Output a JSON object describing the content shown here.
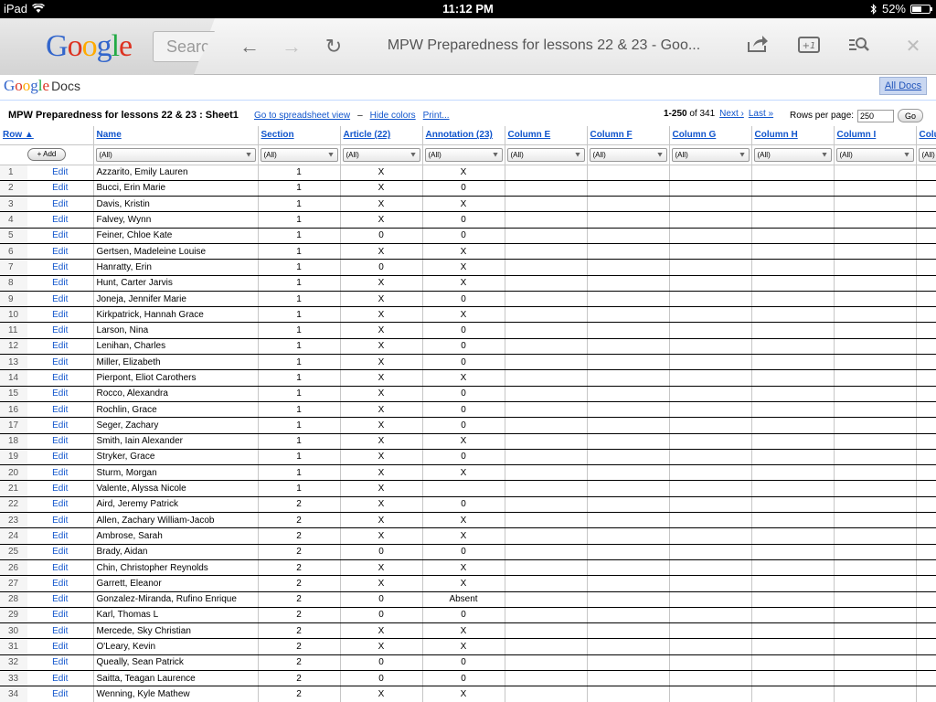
{
  "status_bar": {
    "device": "iPad",
    "time": "11:12 PM",
    "battery": "52%",
    "battery_level": 0.52
  },
  "browser": {
    "search_placeholder": "Search",
    "page_title": "MPW Preparedness for lessons 22 & 23 - Goo...",
    "google_logo": [
      "G",
      "o",
      "o",
      "g",
      "l",
      "e"
    ],
    "logo_colors": [
      "#3366cc",
      "#dd3322",
      "#ffaa00",
      "#3366cc",
      "#22aa44",
      "#dd3322"
    ]
  },
  "docs": {
    "logo_google": "Google",
    "logo_docs": "Docs",
    "all_docs": "All Docs"
  },
  "sheet": {
    "title": "MPW Preparedness for lessons 22 & 23 : Sheet1",
    "links": {
      "spreadsheet_view": "Go to spreadsheet view",
      "separator": "–",
      "hide_colors": "Hide colors",
      "print": "Print..."
    },
    "paging": {
      "range": "1-250",
      "of_text": "of 341",
      "next": "Next ›",
      "last": "Last »"
    },
    "rows_per_page_label": "Rows per page:",
    "rows_per_page_value": "250",
    "go_label": "Go",
    "add_label": "+ Add",
    "filter_all": "(All)",
    "columns": [
      "Row ▲",
      "Name",
      "Section",
      "Article (22)",
      "Annotation (23)",
      "Column E",
      "Column F",
      "Column G",
      "Column H",
      "Column I",
      "Colu"
    ],
    "edit_label": "Edit",
    "rows": [
      [
        "1",
        "Azzarito, Emily Lauren",
        "1",
        "X",
        "X"
      ],
      [
        "2",
        "Bucci, Erin Marie",
        "1",
        "X",
        "0"
      ],
      [
        "3",
        "Davis, Kristin",
        "1",
        "X",
        "X"
      ],
      [
        "4",
        "Falvey, Wynn",
        "1",
        "X",
        "0"
      ],
      [
        "5",
        "Feiner, Chloe Kate",
        "1",
        "0",
        "0"
      ],
      [
        "6",
        "Gertsen, Madeleine Louise",
        "1",
        "X",
        "X"
      ],
      [
        "7",
        "Hanratty, Erin",
        "1",
        "0",
        "X"
      ],
      [
        "8",
        "Hunt, Carter Jarvis",
        "1",
        "X",
        "X"
      ],
      [
        "9",
        "Joneja, Jennifer Marie",
        "1",
        "X",
        "0"
      ],
      [
        "10",
        "Kirkpatrick, Hannah Grace",
        "1",
        "X",
        "X"
      ],
      [
        "11",
        "Larson, Nina",
        "1",
        "X",
        "0"
      ],
      [
        "12",
        "Lenihan, Charles",
        "1",
        "X",
        "0"
      ],
      [
        "13",
        "Miller, Elizabeth",
        "1",
        "X",
        "0"
      ],
      [
        "14",
        "Pierpont, Eliot Carothers",
        "1",
        "X",
        "X"
      ],
      [
        "15",
        "Rocco, Alexandra",
        "1",
        "X",
        "0"
      ],
      [
        "16",
        "Rochlin, Grace",
        "1",
        "X",
        "0"
      ],
      [
        "17",
        "Seger, Zachary",
        "1",
        "X",
        "0"
      ],
      [
        "18",
        "Smith, Iain Alexander",
        "1",
        "X",
        "X"
      ],
      [
        "19",
        "Stryker, Grace",
        "1",
        "X",
        "0"
      ],
      [
        "20",
        "Sturm, Morgan",
        "1",
        "X",
        "X"
      ],
      [
        "21",
        "Valente, Alyssa Nicole",
        "1",
        "X",
        ""
      ],
      [
        "22",
        "Aird, Jeremy Patrick",
        "2",
        "X",
        "0"
      ],
      [
        "23",
        "Allen, Zachary William-Jacob",
        "2",
        "X",
        "X"
      ],
      [
        "24",
        "Ambrose, Sarah",
        "2",
        "X",
        "X"
      ],
      [
        "25",
        "Brady, Aidan",
        "2",
        "0",
        "0"
      ],
      [
        "26",
        "Chin, Christopher Reynolds",
        "2",
        "X",
        "X"
      ],
      [
        "27",
        "Garrett, Eleanor",
        "2",
        "X",
        "X"
      ],
      [
        "28",
        "Gonzalez-Miranda, Rufino Enrique",
        "2",
        "0",
        "Absent"
      ],
      [
        "29",
        "Karl, Thomas L",
        "2",
        "0",
        "0"
      ],
      [
        "30",
        "Mercede, Sky Christian",
        "2",
        "X",
        "X"
      ],
      [
        "31",
        "O'Leary, Kevin",
        "2",
        "X",
        "X"
      ],
      [
        "32",
        "Queally, Sean Patrick",
        "2",
        "0",
        "0"
      ],
      [
        "33",
        "Saitta, Teagan Laurence",
        "2",
        "0",
        "0"
      ],
      [
        "34",
        "Wenning, Kyle Mathew",
        "2",
        "X",
        "X"
      ]
    ]
  }
}
